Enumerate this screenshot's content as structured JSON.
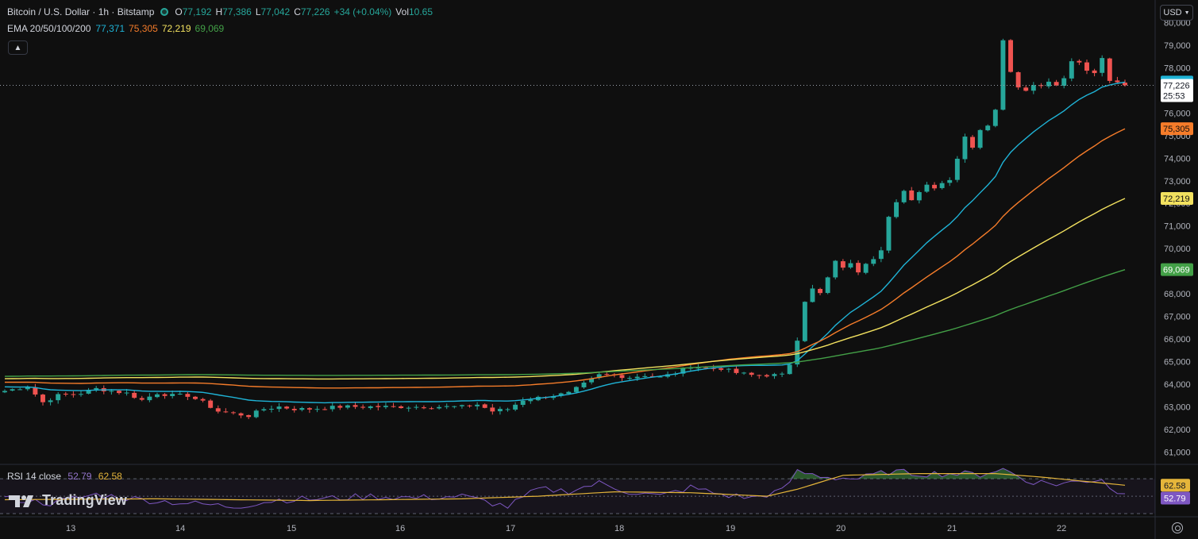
{
  "header": {
    "symbol": "Bitcoin / U.S. Dollar · 1h · Bitstamp",
    "open_label": "O",
    "open": "77,192",
    "high_label": "H",
    "high": "77,386",
    "low_label": "L",
    "low": "77,042",
    "close_label": "C",
    "close": "77,226",
    "change": "+34 (+0.04%)",
    "vol_label": "Vol",
    "vol": "10.65"
  },
  "ema": {
    "label": "EMA 20/50/100/200",
    "v20": "77,371",
    "v50": "75,305",
    "v100": "72,219",
    "v200": "69,069"
  },
  "rsi_header": {
    "label": "RSI 14 close",
    "value": "52.79",
    "ma": "62.58"
  },
  "logo": {
    "text": "TradingView"
  },
  "currency": {
    "label": "USD"
  },
  "colors": {
    "up": "#26a69a",
    "down": "#ef5350",
    "ema20": "#1fb3d6",
    "ema50": "#f57c2a",
    "ema100": "#f2e15f",
    "ema200": "#43a047",
    "rsi": "#7e57c2",
    "rsi_ma": "#e5b53a"
  },
  "chart_data": [
    {
      "type": "line",
      "subtype": "candlestick",
      "x_ticks": [
        "13",
        "14",
        "15",
        "16",
        "17",
        "18",
        "19",
        "20",
        "21",
        "22"
      ],
      "y_ticks": [
        "61,000",
        "62,000",
        "63,000",
        "64,000",
        "65,000",
        "66,000",
        "67,000",
        "68,000",
        "69,000",
        "70,000",
        "71,000",
        "72,000",
        "73,000",
        "74,000",
        "75,000",
        "76,000",
        "77,000",
        "78,000",
        "79,000",
        "80,000"
      ],
      "ylim": [
        60800,
        80300
      ],
      "price_keypoints": [
        [
          0,
          63700
        ],
        [
          3,
          63900
        ],
        [
          5,
          63200
        ],
        [
          7,
          63500
        ],
        [
          10,
          63600
        ],
        [
          12,
          63800
        ],
        [
          14,
          63700
        ],
        [
          16,
          63600
        ],
        [
          18,
          63300
        ],
        [
          20,
          63600
        ],
        [
          22,
          63500
        ],
        [
          24,
          63500
        ],
        [
          26,
          63200
        ],
        [
          28,
          62800
        ],
        [
          30,
          62700
        ],
        [
          32,
          62600
        ],
        [
          34,
          62900
        ],
        [
          36,
          63000
        ],
        [
          38,
          62900
        ],
        [
          40,
          62900
        ],
        [
          44,
          63000
        ],
        [
          48,
          63000
        ],
        [
          52,
          63000
        ],
        [
          56,
          63000
        ],
        [
          60,
          63000
        ],
        [
          62,
          63100
        ],
        [
          64,
          62800
        ],
        [
          66,
          62900
        ],
        [
          68,
          63300
        ],
        [
          70,
          63400
        ],
        [
          72,
          63500
        ],
        [
          74,
          63600
        ],
        [
          76,
          64000
        ],
        [
          78,
          64400
        ],
        [
          80,
          64400
        ],
        [
          82,
          64300
        ],
        [
          84,
          64400
        ],
        [
          86,
          64300
        ],
        [
          88,
          64500
        ],
        [
          90,
          64800
        ],
        [
          92,
          64700
        ],
        [
          94,
          64700
        ],
        [
          96,
          64500
        ],
        [
          98,
          64400
        ],
        [
          100,
          64400
        ],
        [
          102,
          64400
        ],
        [
          103,
          64900
        ],
        [
          104,
          66000
        ],
        [
          105,
          67700
        ],
        [
          106,
          68200
        ],
        [
          107,
          68000
        ],
        [
          108,
          68700
        ],
        [
          109,
          69400
        ],
        [
          110,
          69200
        ],
        [
          111,
          69300
        ],
        [
          112,
          69000
        ],
        [
          113,
          69400
        ],
        [
          114,
          69600
        ],
        [
          115,
          70000
        ],
        [
          116,
          71400
        ],
        [
          117,
          72000
        ],
        [
          118,
          72500
        ],
        [
          119,
          72200
        ],
        [
          120,
          72500
        ],
        [
          121,
          72900
        ],
        [
          122,
          72700
        ],
        [
          123,
          72900
        ],
        [
          124,
          73100
        ],
        [
          125,
          74000
        ],
        [
          126,
          75000
        ],
        [
          127,
          74500
        ],
        [
          128,
          75200
        ],
        [
          129,
          75500
        ],
        [
          130,
          76200
        ],
        [
          131,
          79300
        ],
        [
          132,
          77800
        ],
        [
          133,
          77200
        ],
        [
          134,
          77000
        ],
        [
          135,
          77300
        ],
        [
          136,
          77200
        ],
        [
          137,
          77400
        ],
        [
          138,
          77300
        ],
        [
          139,
          77500
        ],
        [
          140,
          78300
        ],
        [
          141,
          78200
        ],
        [
          142,
          77900
        ],
        [
          143,
          77700
        ],
        [
          144,
          78400
        ],
        [
          145,
          77400
        ],
        [
          146,
          77400
        ],
        [
          147,
          77200
        ]
      ],
      "last_price": 77226,
      "last_price_label": "77,226",
      "countdown": "25:53",
      "series": [
        {
          "name": "EMA 20",
          "last": 77371,
          "label": "77,371"
        },
        {
          "name": "EMA 50",
          "last": 75305,
          "label": "75,305"
        },
        {
          "name": "EMA 100",
          "last": 72219,
          "label": "72,219"
        },
        {
          "name": "EMA 200",
          "last": 69069,
          "label": "69,069"
        }
      ]
    },
    {
      "type": "line",
      "title": "RSI 14 close",
      "ylim": [
        30,
        82
      ],
      "bands": [
        30,
        50,
        70
      ],
      "rsi_keypoints": [
        [
          0,
          48
        ],
        [
          6,
          42
        ],
        [
          12,
          52
        ],
        [
          18,
          46
        ],
        [
          24,
          42
        ],
        [
          30,
          38
        ],
        [
          36,
          46
        ],
        [
          42,
          47
        ],
        [
          48,
          50
        ],
        [
          54,
          48
        ],
        [
          60,
          50
        ],
        [
          66,
          38
        ],
        [
          70,
          58
        ],
        [
          74,
          56
        ],
        [
          78,
          65
        ],
        [
          82,
          55
        ],
        [
          86,
          50
        ],
        [
          90,
          60
        ],
        [
          94,
          52
        ],
        [
          98,
          48
        ],
        [
          102,
          56
        ],
        [
          104,
          78
        ],
        [
          108,
          72
        ],
        [
          112,
          70
        ],
        [
          116,
          78
        ],
        [
          120,
          76
        ],
        [
          124,
          76
        ],
        [
          128,
          75
        ],
        [
          131,
          82
        ],
        [
          134,
          68
        ],
        [
          138,
          64
        ],
        [
          142,
          68
        ],
        [
          144,
          70
        ],
        [
          146,
          52
        ],
        [
          147,
          52.79
        ]
      ],
      "rsi_ma_keypoints": [
        [
          0,
          46
        ],
        [
          20,
          47
        ],
        [
          40,
          45
        ],
        [
          60,
          47
        ],
        [
          70,
          50
        ],
        [
          80,
          55
        ],
        [
          90,
          54
        ],
        [
          100,
          50
        ],
        [
          104,
          58
        ],
        [
          110,
          74
        ],
        [
          120,
          76
        ],
        [
          130,
          76
        ],
        [
          136,
          72
        ],
        [
          147,
          62.58
        ]
      ],
      "series": [
        {
          "name": "RSI",
          "last": 52.79,
          "label": "52.79"
        },
        {
          "name": "MA",
          "last": 62.58,
          "label": "62.58"
        }
      ]
    }
  ]
}
